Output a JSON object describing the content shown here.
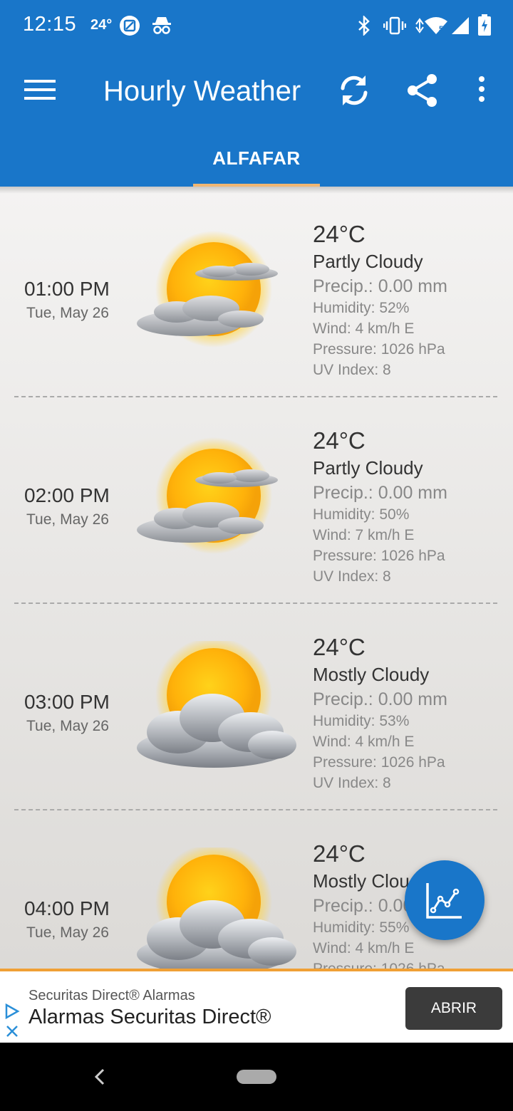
{
  "status_bar": {
    "time": "12:15",
    "temp": "24°",
    "icons": [
      "image-icon",
      "incognito-icon",
      "bluetooth-icon",
      "vibrate-icon",
      "wifi-icon",
      "signal-icon",
      "battery-charging-icon"
    ]
  },
  "toolbar": {
    "title": "Hourly Weather",
    "icons": [
      "menu-icon",
      "refresh-icon",
      "share-icon",
      "more-vert-icon"
    ]
  },
  "tab": {
    "label": "ALFAFAR"
  },
  "forecast": [
    {
      "time": "01:00 PM",
      "date": "Tue, May 26",
      "temp": "24°C",
      "condition": "Partly Cloudy",
      "precip": "Precip.: 0.00 mm",
      "humidity": "Humidity: 52%",
      "wind": "Wind: 4 km/h E",
      "pressure": "Pressure: 1026 hPa",
      "uv": "UV Index: 8",
      "icon": "partly-cloudy-icon"
    },
    {
      "time": "02:00 PM",
      "date": "Tue, May 26",
      "temp": "24°C",
      "condition": "Partly Cloudy",
      "precip": "Precip.: 0.00 mm",
      "humidity": "Humidity: 50%",
      "wind": "Wind: 7 km/h E",
      "pressure": "Pressure: 1026 hPa",
      "uv": "UV Index: 8",
      "icon": "partly-cloudy-icon"
    },
    {
      "time": "03:00 PM",
      "date": "Tue, May 26",
      "temp": "24°C",
      "condition": "Mostly Cloudy",
      "precip": "Precip.: 0.00 mm",
      "humidity": "Humidity: 53%",
      "wind": "Wind: 4 km/h E",
      "pressure": "Pressure: 1026 hPa",
      "uv": "UV Index: 8",
      "icon": "mostly-cloudy-icon"
    },
    {
      "time": "04:00 PM",
      "date": "Tue, May 26",
      "temp": "24°C",
      "condition": "Mostly Cloudy",
      "precip": "Precip.: 0.00 mm",
      "humidity": "Humidity: 55%",
      "wind": "Wind: 4 km/h E",
      "pressure": "Pressure: 1026 hPa",
      "uv": "",
      "icon": "mostly-cloudy-icon"
    }
  ],
  "fab": {
    "icon": "chart-icon"
  },
  "ad": {
    "sponsor": "Securitas Direct® Alarmas",
    "title": "Alarmas Securitas Direct®",
    "button": "ABRIR"
  },
  "colors": {
    "primary": "#1976c9",
    "tab_indicator": "#f0b673",
    "ad_border": "#f0a035"
  }
}
